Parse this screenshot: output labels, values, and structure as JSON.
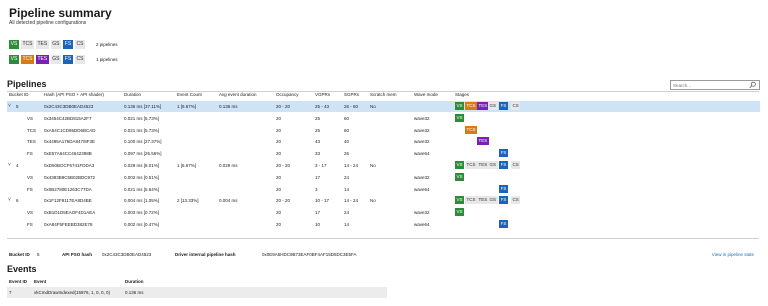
{
  "header": {
    "title": "Pipeline summary",
    "subtitle": "All detected pipeline configurations"
  },
  "summary": [
    {
      "stages": [
        "VS",
        "TCS",
        "TES",
        "GS",
        "FS",
        "CS"
      ],
      "active": [
        "VS",
        "FS"
      ],
      "count_label": "2 pipelines"
    },
    {
      "stages": [
        "VS",
        "TCS",
        "TES",
        "GS",
        "FS",
        "CS"
      ],
      "active": [
        "VS",
        "TCS",
        "TES",
        "FS"
      ],
      "count_label": "1 pipelines"
    }
  ],
  "stage_colors": {
    "VS": "#2e8b3a",
    "TCS": "#d97a12",
    "TES": "#7a1fb8",
    "FS": "#1a65b8",
    "GS": "#e8e8e8",
    "CS": "#e8e8e8"
  },
  "pipelines": {
    "title": "Pipelines",
    "search_placeholder": "Search...",
    "columns": [
      "Bucket ID",
      "Hash (API PSO + API shader)",
      "Duration",
      "Event Count",
      "Avg event duration",
      "Occupancy",
      "VGPRs",
      "SGPRs",
      "Scratch mem",
      "Wave mode",
      "Stages"
    ],
    "rows": [
      {
        "kind": "pipeline",
        "expanded": true,
        "selected": true,
        "id": "5",
        "hash": "0x2C43C3DB0EAD4523",
        "duration": "0.136 ms  [37.11%]",
        "events": "1  [6.67%]",
        "avg": "0.136 ms",
        "occupancy": "20 - 20",
        "vgprs": "25 - 43",
        "sgprs": "26 - 60",
        "scratch": "No",
        "wave": "",
        "stages": [
          "VS",
          "TCS",
          "TES",
          "GS",
          "FS",
          "CS"
        ],
        "active": [
          "VS",
          "TCS",
          "TES",
          "FS"
        ]
      },
      {
        "kind": "shader",
        "id": "VS",
        "hash": "0x3454C42BD815A2F7",
        "duration": "0.021 ms  [5.73%]",
        "occupancy": "20",
        "vgprs": "25",
        "sgprs": "60",
        "wave": "wave32",
        "stage": "VS"
      },
      {
        "kind": "shader",
        "id": "TCS",
        "hash": "0xA54C1CD85DD6BCAD",
        "duration": "0.021 ms  [5.73%]",
        "occupancy": "20",
        "vgprs": "25",
        "sgprs": "60",
        "wave": "wave32",
        "stage": "TCS"
      },
      {
        "kind": "shader",
        "id": "TES",
        "hash": "0x4495A176DA847/8F3E",
        "duration": "0.100 ms  [27.37%]",
        "occupancy": "20",
        "vgprs": "43",
        "sgprs": "40",
        "wave": "wave32",
        "stage": "TES"
      },
      {
        "kind": "shader",
        "id": "FS",
        "hash": "0xE57A64CC4642398B",
        "duration": "0.097 ms  [26.56%]",
        "occupancy": "20",
        "vgprs": "33",
        "sgprs": "26",
        "wave": "wave64",
        "stage": "FS"
      },
      {
        "kind": "pipeline",
        "expanded": true,
        "selected": false,
        "id": "4",
        "hash": "0xD50BOCF6741FDDA3",
        "duration": "0.029 ms  [8.01%]",
        "events": "1  [6.67%]",
        "avg": "0.029 ms",
        "occupancy": "20 - 20",
        "vgprs": "3 - 17",
        "sgprs": "14 - 24",
        "scratch": "No",
        "wave": "",
        "stages": [
          "VS",
          "TCS",
          "TES",
          "GS",
          "FS",
          "CS"
        ],
        "active": [
          "VS",
          "FS"
        ]
      },
      {
        "kind": "shader",
        "id": "VS",
        "hash": "0x4383B8C5B02BDC972",
        "duration": "0.002 ms  [0.51%]",
        "occupancy": "20",
        "vgprs": "17",
        "sgprs": "24",
        "wave": "wave32",
        "stage": "VS"
      },
      {
        "kind": "shader",
        "id": "FS",
        "hash": "0x0B2780E1263C77DA",
        "duration": "0.021 ms  [5.64%]",
        "occupancy": "20",
        "vgprs": "3",
        "sgprs": "14",
        "wave": "wave64",
        "stage": "FS"
      },
      {
        "kind": "pipeline",
        "expanded": true,
        "selected": false,
        "id": "6",
        "hash": "0x1F12F9117EA8D4BE",
        "duration": "0.004 ms  [1.05%]",
        "events": "2  [13.33%]",
        "avg": "0.004 ms",
        "occupancy": "20 - 20",
        "vgprs": "10 - 17",
        "sgprs": "14 - 24",
        "scratch": "No",
        "wave": "",
        "stages": [
          "VS",
          "TCS",
          "TES",
          "GS",
          "FS",
          "CS"
        ],
        "active": [
          "VS",
          "FS"
        ]
      },
      {
        "kind": "shader",
        "id": "VS",
        "hash": "0xB1D1D5EAOF4D1AEA",
        "duration": "0.003 ms  [0.72%]",
        "occupancy": "20",
        "vgprs": "17",
        "sgprs": "24",
        "wave": "wave32",
        "stage": "VS"
      },
      {
        "kind": "shader",
        "id": "FS",
        "hash": "0xA84F5FEEBD382E78",
        "duration": "0.002 ms  [0.47%]",
        "occupancy": "20",
        "vgprs": "10",
        "sgprs": "14",
        "wave": "wave64",
        "stage": "FS"
      }
    ]
  },
  "detail": {
    "bucket_label": "Bucket ID",
    "bucket_value": "5",
    "api_hash_label": "API PSO hash",
    "api_hash_value": "0x2C43C3DB0EAD4523",
    "driver_hash_label": "Driver internal pipeline hash",
    "driver_hash_value": "0x0E9A5HDC9B73EAF0BF4AF15D5DC3E5FA",
    "view_link": "View in pipeline state"
  },
  "events": {
    "title": "Events",
    "columns": [
      "Event ID",
      "Event",
      "Duration"
    ],
    "rows": [
      {
        "id": "7",
        "event": "vkCmdDrawIndexed(15876, 1, 0, 0, 0)",
        "duration": "0.136 ms"
      }
    ]
  }
}
